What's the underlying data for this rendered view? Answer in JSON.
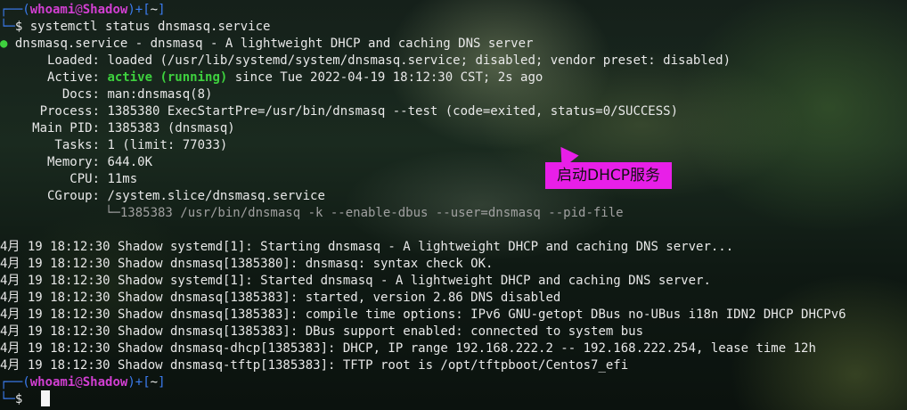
{
  "prompt": {
    "user": "whoami",
    "at": "@",
    "host": "Shadow",
    "dir": "~",
    "dollar": "$"
  },
  "command": "systemctl status dnsmasq.service",
  "status": {
    "dot": "●",
    "service_line": "dnsmasq.service - dnsmasq - A lightweight DHCP and caching DNS server",
    "fields": [
      {
        "key": "Loaded:",
        "value": "loaded (/usr/lib/systemd/system/dnsmasq.service; disabled; vendor preset: disabled)"
      },
      {
        "key": "Active:",
        "value_active": "active (running)",
        "value": " since Tue 2022-04-19 18:12:30 CST; 2s ago"
      },
      {
        "key": "Docs:",
        "value": "man:dnsmasq(8)"
      },
      {
        "key": "Process:",
        "value": "1385380 ExecStartPre=/usr/bin/dnsmasq --test (code=exited, status=0/SUCCESS)"
      },
      {
        "key": "Main PID:",
        "value": "1385383 (dnsmasq)"
      },
      {
        "key": "Tasks:",
        "value": "1 (limit: 77033)"
      },
      {
        "key": "Memory:",
        "value": "644.0K"
      },
      {
        "key": "CPU:",
        "value": "11ms"
      },
      {
        "key": "CGroup:",
        "value": "/system.slice/dnsmasq.service"
      }
    ],
    "cgroup_child": "└─1385383 /usr/bin/dnsmasq -k --enable-dbus --user=dnsmasq --pid-file"
  },
  "logs": [
    "4月 19 18:12:30 Shadow systemd[1]: Starting dnsmasq - A lightweight DHCP and caching DNS server...",
    "4月 19 18:12:30 Shadow dnsmasq[1385380]: dnsmasq: syntax check OK.",
    "4月 19 18:12:30 Shadow systemd[1]: Started dnsmasq - A lightweight DHCP and caching DNS server.",
    "4月 19 18:12:30 Shadow dnsmasq[1385383]: started, version 2.86 DNS disabled",
    "4月 19 18:12:30 Shadow dnsmasq[1385383]: compile time options: IPv6 GNU-getopt DBus no-UBus i18n IDN2 DHCP DHCPv6",
    "4月 19 18:12:30 Shadow dnsmasq[1385383]: DBus support enabled: connected to system bus",
    "4月 19 18:12:30 Shadow dnsmasq-dhcp[1385383]: DHCP, IP range 192.168.222.2 -- 192.168.222.254, lease time 12h",
    "4月 19 18:12:30 Shadow dnsmasq-tftp[1385383]: TFTP root is /opt/tftpboot/Centos7_efi"
  ],
  "annotation": "启动DHCP服务",
  "colors": {
    "prompt_user": "#d23fd2",
    "prompt_bracket": "#3b7cf0",
    "active_green": "#3ed13e",
    "annotation_bg": "#e81fe8"
  }
}
